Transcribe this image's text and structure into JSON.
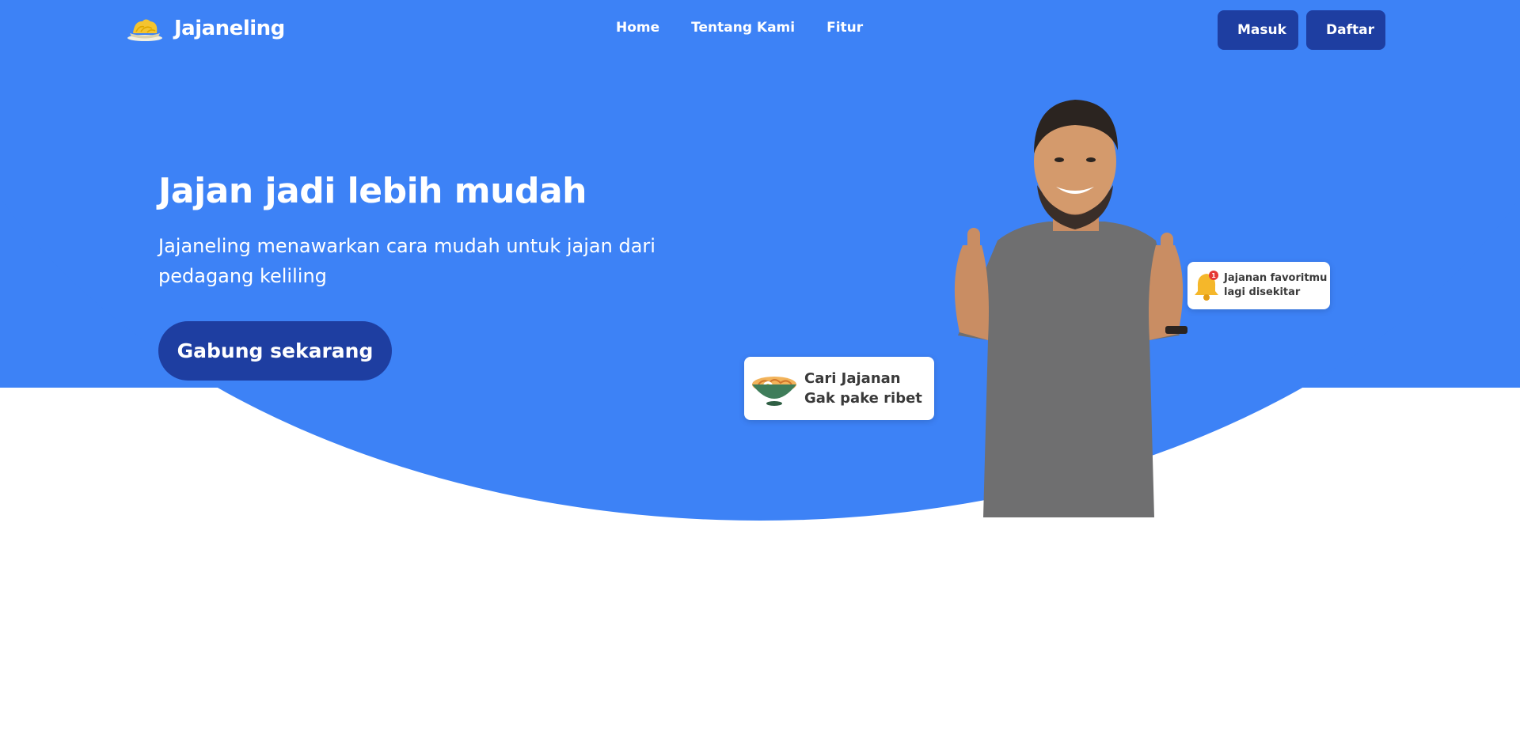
{
  "brand": {
    "name": "Jajaneling",
    "logo_icon": "noodle-bowl-icon"
  },
  "nav": {
    "items": [
      "Home",
      "Tentang Kami",
      "Fitur"
    ]
  },
  "auth": {
    "login_label": "Masuk",
    "register_label": "Daftar"
  },
  "hero": {
    "headline": "Jajan jadi lebih mudah",
    "subline": "Jajaneling menawarkan cara mudah untuk jajan dari pedagang keliling",
    "cta_label": "Gabung sekarang",
    "food_card": {
      "icon": "noodle-bowl-icon",
      "line1": "Cari Jajanan",
      "line2": "Gak pake ribet"
    },
    "notify_card": {
      "icon": "bell-icon",
      "badge": "1",
      "line1": "Jajanan favoritmu",
      "line2": "lagi disekitar"
    }
  },
  "colors": {
    "primary": "#3d82f6",
    "button": "#1e3ea1",
    "card_text": "#3a3a3a"
  }
}
